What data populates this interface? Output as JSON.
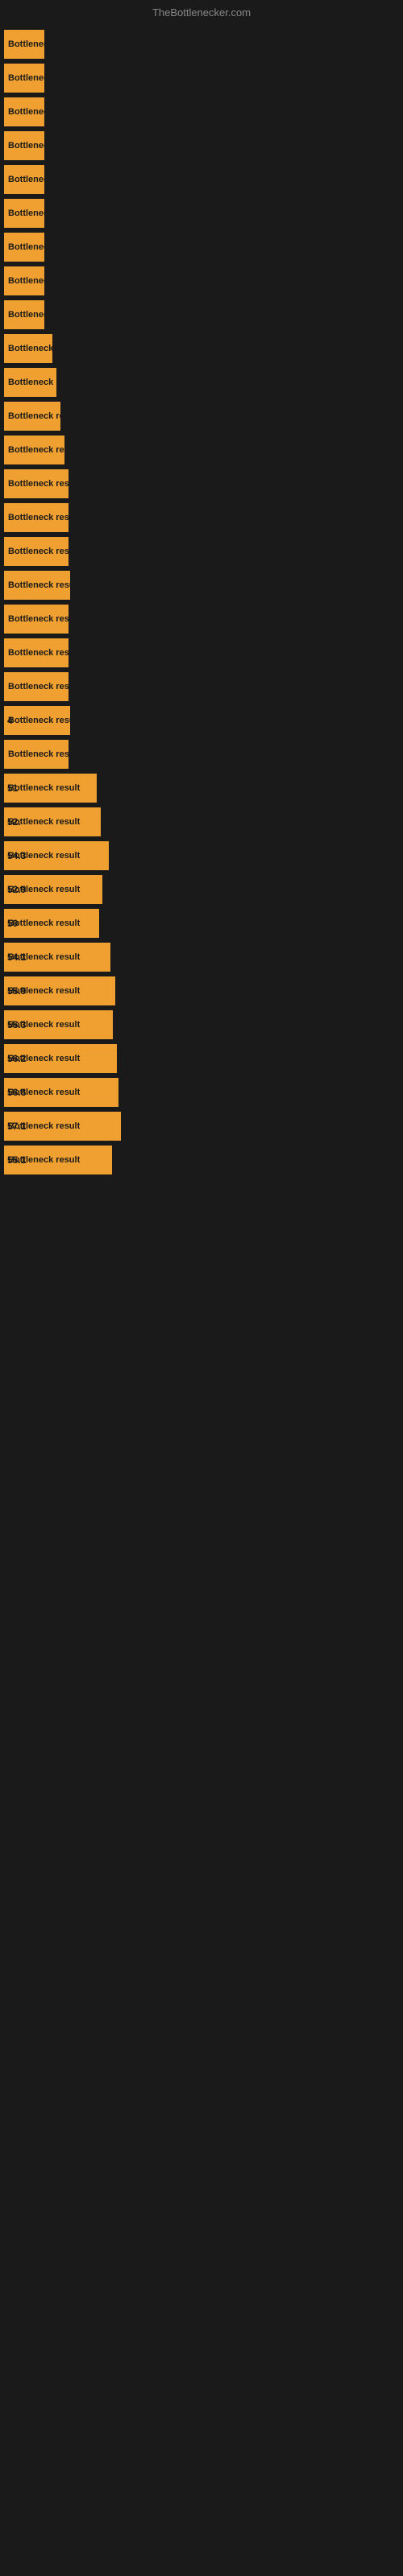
{
  "site": {
    "title": "TheBottlenecker.com"
  },
  "chart": {
    "bars": [
      {
        "label": "Bottleneck result",
        "width": 50,
        "value": ""
      },
      {
        "label": "Bottleneck result",
        "width": 50,
        "value": ""
      },
      {
        "label": "Bottleneck result",
        "width": 50,
        "value": ""
      },
      {
        "label": "Bottleneck result",
        "width": 50,
        "value": ""
      },
      {
        "label": "Bottleneck result",
        "width": 50,
        "value": ""
      },
      {
        "label": "Bottleneck result",
        "width": 50,
        "value": ""
      },
      {
        "label": "Bottleneck result",
        "width": 50,
        "value": ""
      },
      {
        "label": "Bottleneck result",
        "width": 50,
        "value": ""
      },
      {
        "label": "Bottleneck result",
        "width": 50,
        "value": ""
      },
      {
        "label": "Bottleneck result",
        "width": 60,
        "value": ""
      },
      {
        "label": "Bottleneck result",
        "width": 65,
        "value": ""
      },
      {
        "label": "Bottleneck result",
        "width": 70,
        "value": ""
      },
      {
        "label": "Bottleneck result",
        "width": 75,
        "value": ""
      },
      {
        "label": "Bottleneck result",
        "width": 80,
        "value": ""
      },
      {
        "label": "Bottleneck result",
        "width": 80,
        "value": ""
      },
      {
        "label": "Bottleneck result",
        "width": 80,
        "value": ""
      },
      {
        "label": "Bottleneck result",
        "width": 82,
        "value": ""
      },
      {
        "label": "Bottleneck result",
        "width": 80,
        "value": ""
      },
      {
        "label": "Bottleneck result",
        "width": 80,
        "value": ""
      },
      {
        "label": "Bottleneck result",
        "width": 80,
        "value": ""
      },
      {
        "label": "Bottleneck result",
        "width": 82,
        "value": "4"
      },
      {
        "label": "Bottleneck result",
        "width": 80,
        "value": ""
      },
      {
        "label": "Bottleneck result",
        "width": 115,
        "value": "51"
      },
      {
        "label": "Bottleneck result",
        "width": 120,
        "value": "52."
      },
      {
        "label": "Bottleneck result",
        "width": 130,
        "value": "54.3"
      },
      {
        "label": "Bottleneck result",
        "width": 122,
        "value": "52.9"
      },
      {
        "label": "Bottleneck result",
        "width": 118,
        "value": "50"
      },
      {
        "label": "Bottleneck result",
        "width": 132,
        "value": "54.1"
      },
      {
        "label": "Bottleneck result",
        "width": 138,
        "value": "55.9"
      },
      {
        "label": "Bottleneck result",
        "width": 135,
        "value": "55.3"
      },
      {
        "label": "Bottleneck result",
        "width": 140,
        "value": "56.2"
      },
      {
        "label": "Bottleneck result",
        "width": 142,
        "value": "56.6"
      },
      {
        "label": "Bottleneck result",
        "width": 145,
        "value": "57.1"
      },
      {
        "label": "Bottleneck result",
        "width": 134,
        "value": "55.1"
      }
    ]
  }
}
